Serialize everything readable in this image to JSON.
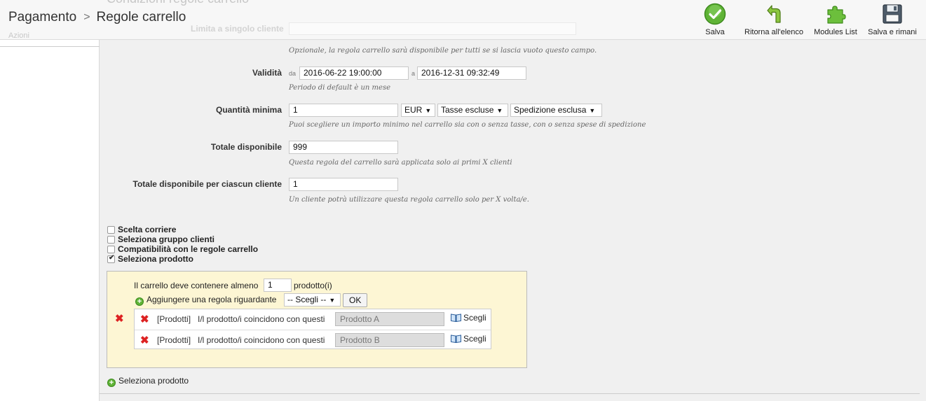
{
  "ghost": {
    "title": "Condizioni regole carrello",
    "label": "Limita a singolo cliente",
    "tab": "Azioni"
  },
  "breadcrumb": {
    "parent": "Pagamento",
    "separator": ">",
    "current": "Regole carrello"
  },
  "toolbar": {
    "save": "Salva",
    "back": "Ritorna all'elenco",
    "modules": "Modules List",
    "save_remain": "Salva e rimani"
  },
  "colors": {
    "content_bg": "#f0f0f0",
    "product_box_bg": "#fdf6d4",
    "save_green": "#5fb336",
    "remove_red": "#d22222"
  },
  "form": {
    "customer_hint": "Opzionale, la regola carrello sarà disponibile per tutti se si lascia vuoto questo campo.",
    "validity": {
      "label": "Validità",
      "from_label": "da",
      "from": "2016-06-22 19:00:00",
      "to_label": "a",
      "to": "2016-12-31 09:32:49",
      "hint": "Periodo di default è un mese"
    },
    "min_amount": {
      "label": "Quantità minima",
      "value": "1",
      "currency": "EUR",
      "tax": "Tasse escluse",
      "shipping": "Spedizione esclusa",
      "hint": "Puoi scegliere un importo minimo nel carrello sia con o senza tasse, con o senza spese di spedizione"
    },
    "total_available": {
      "label": "Totale disponibile",
      "value": "999",
      "hint": "Questa regola del carrello sarà applicata solo ai primi X clienti"
    },
    "total_per_customer": {
      "label": "Totale disponibile per ciascun cliente",
      "value": "1",
      "hint": "Un cliente potrà utilizzare questa regola carrello solo per X volta/e."
    }
  },
  "restrictions": [
    {
      "label": "Scelta corriere",
      "checked": false
    },
    {
      "label": "Seleziona gruppo clienti",
      "checked": false
    },
    {
      "label": "Compatibilità con le regole carrello",
      "checked": false
    },
    {
      "label": "Seleziona prodotto",
      "checked": true
    }
  ],
  "product_box": {
    "prefix": "Il carrello deve contenere almeno",
    "qty": "1",
    "suffix": "prodotto(i)",
    "add_rule": "Aggiungere una regola riguardante",
    "choose_option": "-- Scegli --",
    "ok": "OK",
    "rules": [
      {
        "type": "[Prodotti]",
        "text": "I/l prodotto/i coincidono con questi",
        "value": "Prodotto A",
        "choose": "Scegli"
      },
      {
        "type": "[Prodotti]",
        "text": "I/l prodotto/i coincidono con questi",
        "value": "Prodotto B",
        "choose": "Scegli"
      }
    ]
  },
  "add_product_selection": "Seleziona prodotto"
}
